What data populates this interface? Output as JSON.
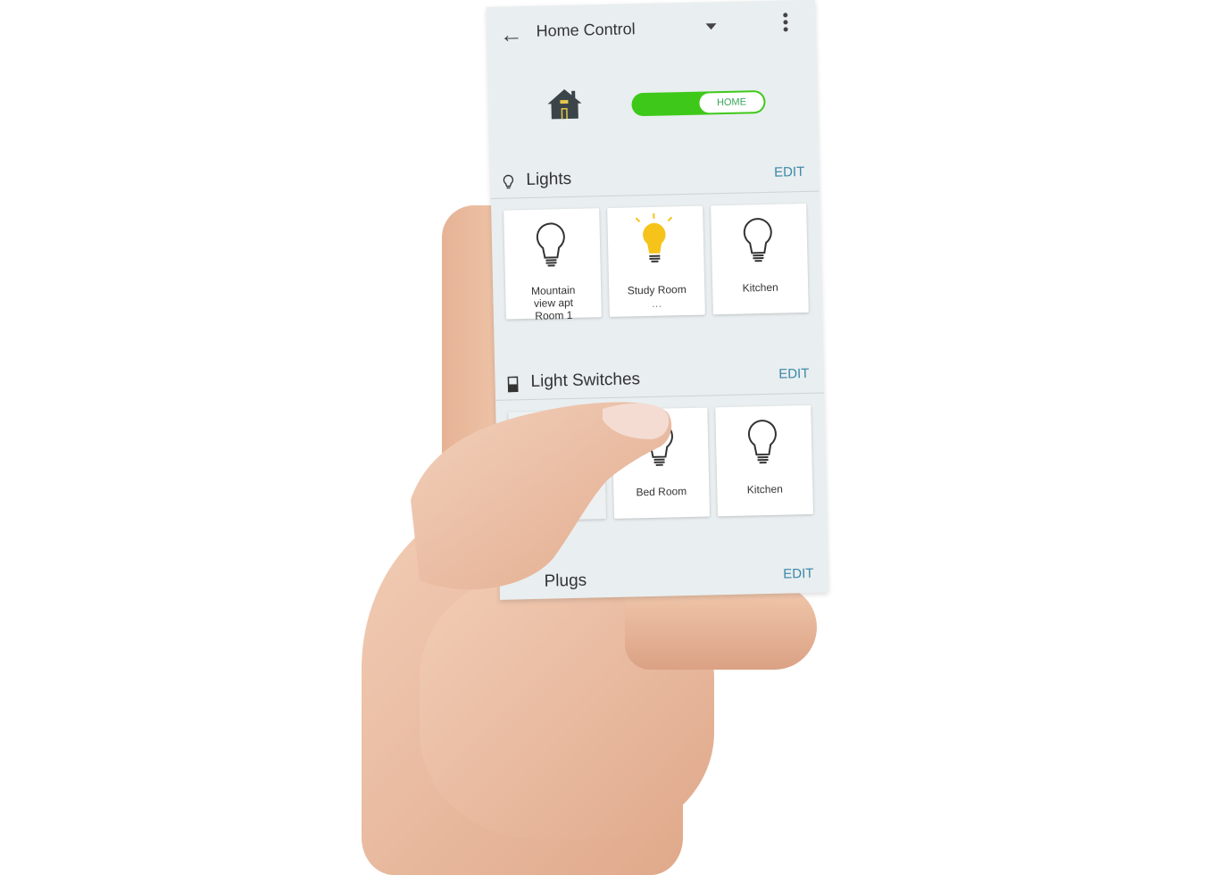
{
  "app": {
    "title": "Home Control",
    "back_icon": "arrow-left-icon",
    "dropdown_icon": "caret-down-icon",
    "menu_icon": "more-vertical-icon"
  },
  "mode": {
    "icon": "house-icon",
    "toggle_label": "HOME",
    "toggle_on": true,
    "accent": "#3ec91a"
  },
  "sections": [
    {
      "label": "Lights",
      "icon": "bulb-outline-icon",
      "edit": "EDIT",
      "tiles": [
        {
          "name": "Mountain view apt Room 1",
          "on": false
        },
        {
          "name": "Study Room",
          "on": true,
          "dots": "..."
        },
        {
          "name": "Kitchen",
          "on": false
        }
      ]
    },
    {
      "label": "Light Switches",
      "icon": "switch-icon",
      "edit": "EDIT",
      "tiles": [
        {
          "name": "Bed Room",
          "on": false
        },
        {
          "name": "Kitchen",
          "on": false
        }
      ]
    },
    {
      "label": "Plugs",
      "edit": "EDIT"
    }
  ],
  "colors": {
    "bulb_on": "#f6c31a",
    "edit_link": "#3a88a8",
    "background": "#e9eef0"
  }
}
